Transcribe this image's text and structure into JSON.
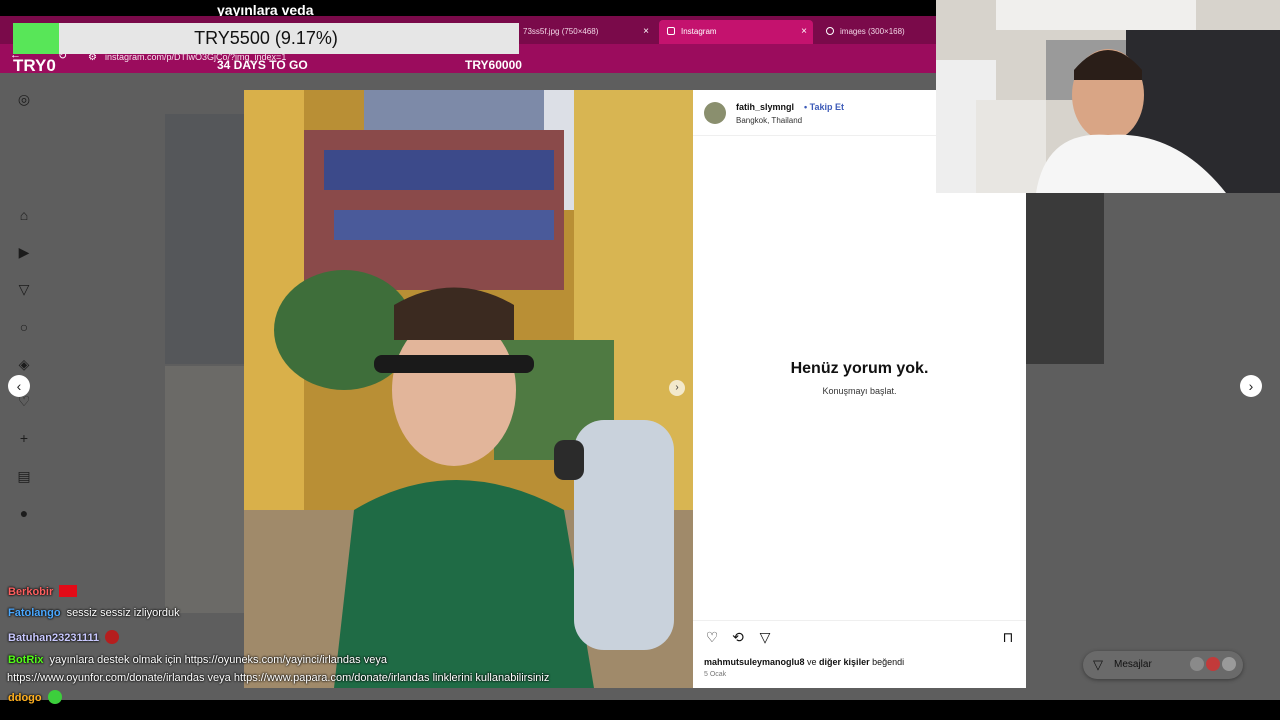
{
  "stream": {
    "title": "yayınlara veda",
    "goal": {
      "label": "TRY5500 (9.17%)",
      "progress_percent": 9.17,
      "min": "TRY0",
      "days": "34 DAYS TO GO",
      "max": "TRY60000"
    }
  },
  "browser": {
    "tabs": [
      {
        "label": "73ss5f.jpg (750×468)",
        "active": false
      },
      {
        "label": "Instagram",
        "active": true
      },
      {
        "label": "images (300×168)",
        "active": false
      }
    ],
    "url": "instagram.com/p/DTIwO3GjCo/?img_index=1",
    "close_glyph": "×"
  },
  "instagram": {
    "post": {
      "author": "fatih_slymngl",
      "follow_label": "Takip Et",
      "separator": "•",
      "location": "Bangkok, Thailand",
      "empty_title": "Henüz yorum yok.",
      "empty_subtitle": "Konuşmayı başlat.",
      "likes_user": "mahmutsuleymanoglu8",
      "likes_mid": " ve ",
      "likes_others": "diğer kişiler",
      "likes_suffix": " beğendi",
      "date": "5 Ocak"
    },
    "messages_label": "Mesajlar",
    "rail_icons": [
      "instagram-icon",
      "home-icon",
      "reels-icon",
      "send-icon",
      "search-icon",
      "explore-icon",
      "heart-icon",
      "create-icon",
      "dashboard-icon",
      "profile-icon"
    ]
  },
  "chat": [
    {
      "name": "Berkobir",
      "name_color": "#ff5f5f",
      "text": "",
      "badge": "flag-tr"
    },
    {
      "name": "Fatolango",
      "name_color": "#4aa8ff",
      "text": "sessiz sessiz izliyorduk"
    },
    {
      "name": "Batuhan23231111",
      "name_color": "#c9c9ff",
      "text": "",
      "badge": "emote"
    },
    {
      "name": "BotRix",
      "name_color": "#53fc18",
      "text": "yayınlara destek olmak için https://oyuneks.com/yayinci/irlandas veya"
    },
    {
      "name": "",
      "name_color": "#ffffff",
      "text": "https://www.oyunfor.com/donate/irlandas veya https://www.papara.com/donate/irlandas linklerini kullanabilirsiniz"
    },
    {
      "name": "ddogo",
      "name_color": "#ffb020",
      "text": "",
      "badge": "emote-green"
    }
  ],
  "colors": {
    "tab_bar": "#7a0a4a",
    "address_bar": "#9b0c5d",
    "goal_fill": "#58e658",
    "follow_link": "#3d5bb8"
  }
}
